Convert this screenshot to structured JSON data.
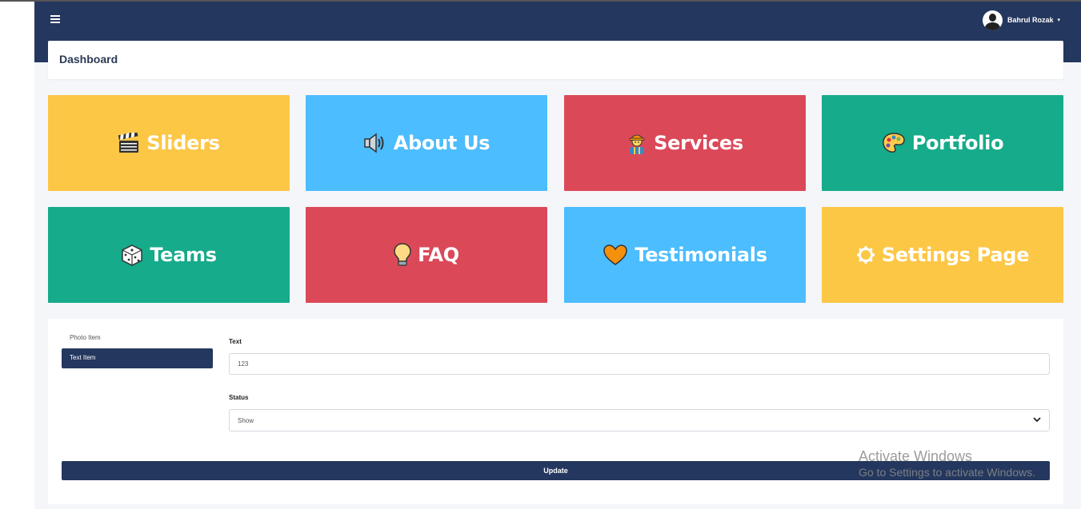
{
  "navbar": {
    "menu_icon": "hamburger-icon",
    "user_name": "Bahrul Rozak",
    "user_caret": "▾",
    "background": "#24375e"
  },
  "header": {
    "title": "Dashboard"
  },
  "tiles": [
    {
      "label": "Sliders",
      "icon": "clapper-board-icon",
      "color": "#fdc746"
    },
    {
      "label": "About Us",
      "icon": "speaker-icon",
      "color": "#4cbdfe"
    },
    {
      "label": "Services",
      "icon": "construction-worker-icon",
      "color": "#db4959"
    },
    {
      "label": "Portfolio",
      "icon": "artist-palette-icon",
      "color": "#16ab8a"
    },
    {
      "label": "Teams",
      "icon": "game-die-icon",
      "color": "#16ab8a"
    },
    {
      "label": "FAQ",
      "icon": "light-bulb-icon",
      "color": "#db4959"
    },
    {
      "label": "Testimonials",
      "icon": "heart-icon",
      "color": "#4cbdfe"
    },
    {
      "label": "Settings Page",
      "icon": "gear-icon",
      "color": "#fdc746"
    }
  ],
  "form": {
    "tabs": [
      {
        "label": "Photo Item",
        "active": false
      },
      {
        "label": "Text Item",
        "active": true
      }
    ],
    "text_label": "Text",
    "text_value": "123",
    "status_label": "Status",
    "status_value": "Show",
    "update_label": "Update"
  },
  "watermark": {
    "title": "Activate Windows",
    "subtitle": "Go to Settings to activate Windows."
  }
}
